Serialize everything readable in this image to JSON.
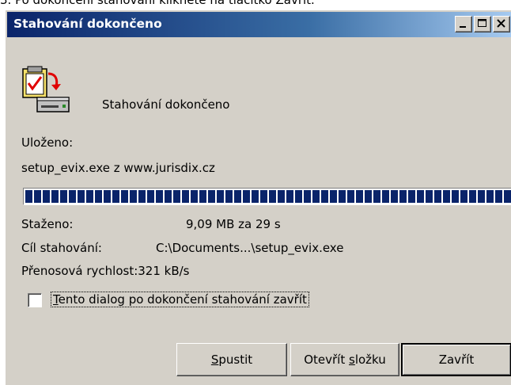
{
  "page_top_text": "3. Po dokončení stahování klikněte na tlačítko Zavřít.",
  "window": {
    "title": "Stahování dokončeno",
    "controls": {
      "minimize": "minimize-icon",
      "maximize": "maximize-icon",
      "close": "close-icon"
    }
  },
  "header": {
    "message": "Stahování dokončeno",
    "icon": "download-complete-icon"
  },
  "saved": {
    "label": "Uloženo:",
    "file_source": "setup_evix.exe z www.jurisdix.cz"
  },
  "progress": {
    "percent": 100
  },
  "details": {
    "downloaded_label": "Staženo:",
    "downloaded_value": "9,09 MB za 29 s",
    "target_label": "Cíl stahování:",
    "target_value": "C:\\Documents...\\setup_evix.exe",
    "rate_text": "Přenosová rychlost:321 kB/s"
  },
  "checkbox": {
    "checked": false,
    "label_prefix": "T",
    "label_rest": "ento dialog po dokončení stahování zavřít"
  },
  "buttons": {
    "run_prefix": "S",
    "run_rest": "pustit",
    "open_prefix": "Otevřít ",
    "open_accel": "s",
    "open_rest": "ložku",
    "close": "Zavřít"
  },
  "colors": {
    "title_gradient_start": "#0a246a",
    "title_gradient_end": "#a6caf0",
    "dialog_bg": "#d4d0c8",
    "progress_fill": "#0a246a"
  }
}
